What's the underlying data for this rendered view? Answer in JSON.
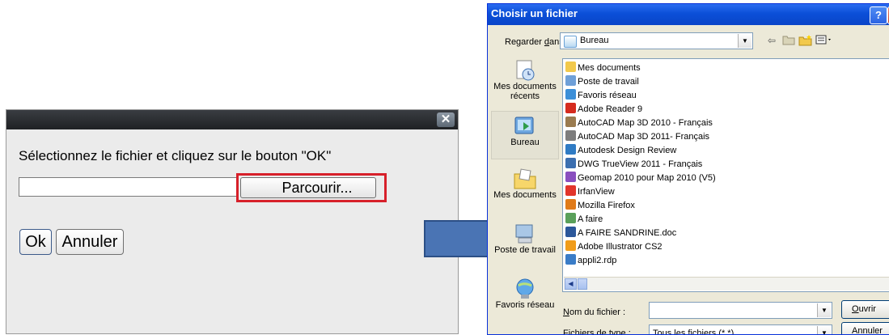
{
  "upload_dialog": {
    "close_glyph": "✕",
    "prompt": "Sélectionnez le fichier et cliquez sur le bouton \"OK\"",
    "path_value": "",
    "browse_label": "Parcourir...",
    "ok_label": "Ok",
    "cancel_label": "Annuler",
    "highlight_color": "#d7202a"
  },
  "arrow": {
    "color": "#4a74b4",
    "direction": "right"
  },
  "file_chooser": {
    "title": "Choisir un fichier",
    "help_glyph": "?",
    "look_in": {
      "label_pre": "Regarder ",
      "label_underlined": "d",
      "label_post": "ans :",
      "value": "Bureau"
    },
    "toolbar_icons": [
      "back-icon",
      "up-folder-icon",
      "new-folder-icon",
      "view-menu-icon"
    ],
    "places": [
      {
        "label": "Mes documents récents",
        "icon": "recent-documents-icon"
      },
      {
        "label": "Bureau",
        "icon": "desktop-icon",
        "selected": true
      },
      {
        "label": "Mes documents",
        "icon": "my-documents-icon"
      },
      {
        "label": "Poste de travail",
        "icon": "my-computer-icon"
      },
      {
        "label": "Favoris réseau",
        "icon": "network-places-icon"
      }
    ],
    "files": [
      {
        "name": "Mes documents",
        "icon": "folder-icon",
        "color": "#f2c94c"
      },
      {
        "name": "Poste de travail",
        "icon": "computer-icon",
        "color": "#6fa0d8"
      },
      {
        "name": "Favoris réseau",
        "icon": "network-icon",
        "color": "#3c8fd8"
      },
      {
        "name": "Adobe Reader 9",
        "icon": "adobe-reader-icon",
        "color": "#d52b1e"
      },
      {
        "name": "AutoCAD Map 3D 2010 - Français",
        "icon": "autocad-icon",
        "color": "#9a7b4f"
      },
      {
        "name": "AutoCAD Map 3D 2011- Français",
        "icon": "autocad-icon",
        "color": "#7d7d7d"
      },
      {
        "name": "Autodesk Design Review",
        "icon": "design-review-icon",
        "color": "#2f7bc4"
      },
      {
        "name": "DWG TrueView 2011 - Français",
        "icon": "dwg-trueview-icon",
        "color": "#3c6fb0"
      },
      {
        "name": "Geomap 2010 pour Map 2010 (V5)",
        "icon": "geomap-icon",
        "color": "#8a4fbf"
      },
      {
        "name": "IrfanView",
        "icon": "irfanview-icon",
        "color": "#e2352b"
      },
      {
        "name": "Mozilla Firefox",
        "icon": "firefox-icon",
        "color": "#e07b1a"
      },
      {
        "name": "A faire",
        "icon": "shortcut-icon",
        "color": "#5aa05a"
      },
      {
        "name": "A FAIRE SANDRINE.doc",
        "icon": "word-doc-icon",
        "color": "#2b579a"
      },
      {
        "name": "Adobe Illustrator CS2",
        "icon": "illustrator-icon",
        "color": "#f09c1a"
      },
      {
        "name": "appli2.rdp",
        "icon": "rdp-icon",
        "color": "#3a7cc7"
      }
    ],
    "filename": {
      "label_underlined": "N",
      "label_post": "om du fichier :",
      "value": ""
    },
    "filetype": {
      "label_pre": "Fichiers de ",
      "label_underlined": "t",
      "label_post": "ype :",
      "value": "Tous les fichiers (*.*)"
    },
    "open_label_underlined": "O",
    "open_label_post": "uvrir",
    "cancel_label": "Annuler"
  }
}
